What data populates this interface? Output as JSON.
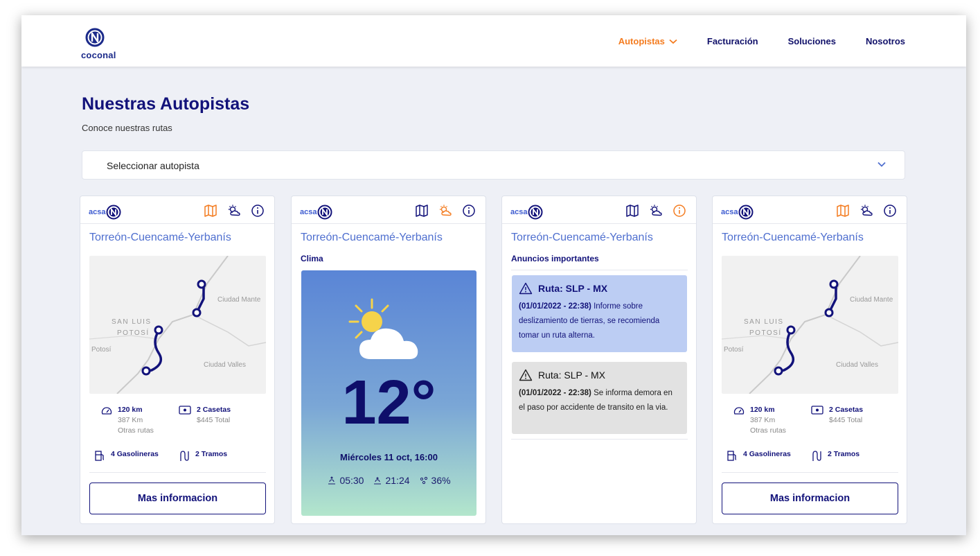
{
  "brand": {
    "logo_text": "coconal"
  },
  "nav": {
    "items": [
      {
        "label": "Autopistas",
        "active": true
      },
      {
        "label": "Facturación",
        "active": false
      },
      {
        "label": "Soluciones",
        "active": false
      },
      {
        "label": "Nosotros",
        "active": false
      }
    ]
  },
  "page": {
    "title": "Nuestras Autopistas",
    "subtitle": "Conoce nuestras rutas"
  },
  "selector": {
    "label": "Seleccionar autopista"
  },
  "cards": [
    {
      "brand": "acsa",
      "route": "Torreón-Cuencamé-Yerbanís",
      "active_icon": "map-icon",
      "map_labels": [
        "SAN LUIS",
        "POTOSÍ",
        "Ciudad Mante",
        "Potosí",
        "Ciudad Valles"
      ],
      "distance": "120 km",
      "distance_other": "387 Km",
      "distance_other_label": "Otras rutas",
      "booths": "2 Casetas",
      "booths_total": "$445 Total",
      "gas": "4 Gasolineras",
      "segments": "2 Tramos",
      "button": "Mas informacion"
    },
    {
      "brand": "acsa",
      "route": "Torreón-Cuencamé-Yerbanís",
      "active_icon": "weather-icon",
      "section": "Clima",
      "temperature": "12°",
      "date": "Miércoles 11 oct, 16:00",
      "sunrise": "05:30",
      "sunset": "21:24",
      "humidity": "36%"
    },
    {
      "brand": "acsa",
      "route": "Torreón-Cuencamé-Yerbanís",
      "active_icon": "info-icon",
      "section": "Anuncios importantes",
      "announcements": [
        {
          "title": "Ruta: SLP - MX",
          "date": "(01/01/2022 - 22:38)",
          "text": "Informe sobre deslizamiento de tierras, se recomienda tomar un ruta alterna."
        },
        {
          "title": "Ruta: SLP - MX",
          "date": "(01/01/2022 - 22:38)",
          "text": "Se informa demora en el paso por accidente de transito en la via."
        }
      ]
    },
    {
      "brand": "acsa",
      "route": "Torreón-Cuencamé-Yerbanís",
      "active_icon": "map-icon",
      "map_labels": [
        "SAN LUIS",
        "POTOSÍ",
        "Ciudad Mante",
        "Potosí",
        "Ciudad Valles"
      ],
      "distance": "120 km",
      "distance_other": "387 Km",
      "distance_other_label": "Otras rutas",
      "booths": "2 Casetas",
      "booths_total": "$445 Total",
      "gas": "4 Gasolineras",
      "segments": "2 Tramos",
      "button": "Mas informacion"
    }
  ],
  "colors": {
    "accent": "#f47c20",
    "navy": "#12127a",
    "route_blue": "#4f6fcf",
    "background": "#eef0f6"
  }
}
